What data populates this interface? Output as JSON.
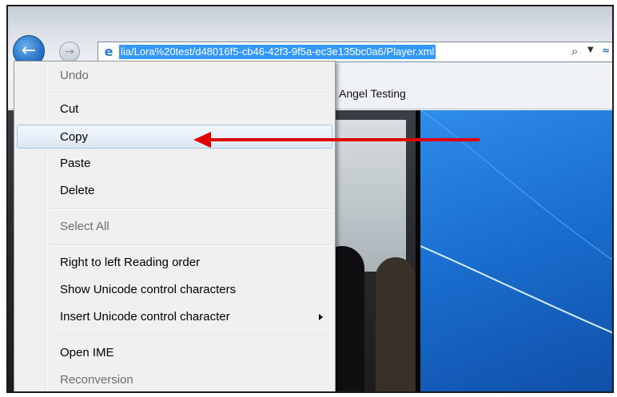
{
  "browser": {
    "address_url": "lia/Lora%20test/d48016f5-cb46-42f3-9f5a-ec3e135bc0a6/Player.xml",
    "tab_title": "Angel Testing",
    "icons": {
      "back": "back-arrow-icon",
      "forward": "forward-arrow-icon",
      "site": "ie-logo-icon",
      "search": "search-icon",
      "dropdown": "chevron-down-icon",
      "compat": "compatibility-view-icon"
    }
  },
  "context_menu": {
    "items": [
      {
        "label": "Undo",
        "enabled": false
      },
      {
        "label": "Cut",
        "enabled": true
      },
      {
        "label": "Copy",
        "enabled": true,
        "highlighted": true
      },
      {
        "label": "Paste",
        "enabled": true
      },
      {
        "label": "Delete",
        "enabled": true
      },
      {
        "label": "Select All",
        "enabled": false
      },
      {
        "label": "Right to left Reading order",
        "enabled": true
      },
      {
        "label": "Show Unicode control characters",
        "enabled": true
      },
      {
        "label": "Insert Unicode control character",
        "enabled": true,
        "has_submenu": true
      },
      {
        "label": "Open IME",
        "enabled": true
      },
      {
        "label": "Reconversion",
        "enabled": false
      }
    ]
  },
  "annotation": {
    "color": "#e10000",
    "points_to": "Copy"
  }
}
